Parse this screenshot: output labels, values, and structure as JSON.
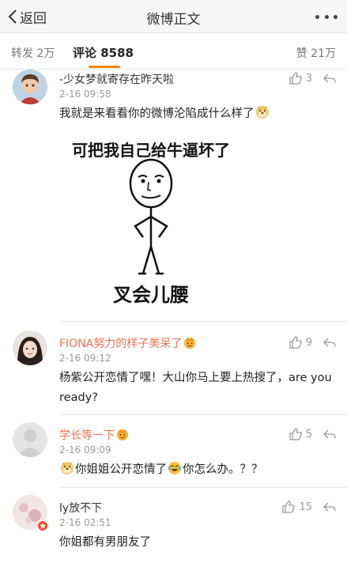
{
  "header": {
    "back_label": "返回",
    "title": "微博正文"
  },
  "tabs": {
    "reposts": "转发 2万",
    "comments": "评论 8588",
    "likes": "赞 21万"
  },
  "comments": [
    {
      "user": "-少女梦就寄存在昨天啦",
      "time": "2-16 09:58",
      "text": "我就是来看看你的微博沦陷成什么样了",
      "likes": "3",
      "user_color": "#333333",
      "meme": {
        "top_text": "可把我自己给牛逼坏了",
        "bottom_text": "叉会儿腰"
      }
    },
    {
      "user": "FIONA努力的样子美呆了",
      "time": "2-16 09:12",
      "text": "杨紫公开恋情了嘿！大山你马上要上热搜了，are you ready?",
      "likes": "9",
      "user_color": "#eb7350"
    },
    {
      "user": "学长等一下",
      "time": "2-16 09:09",
      "text_a": "你姐姐公开恋情了",
      "text_b": "你怎么办。？？",
      "likes": "5",
      "user_color": "#eb7350"
    },
    {
      "user": "ly放不下",
      "time": "2-16 02:51",
      "text": "你姐都有男朋友了",
      "likes": "15",
      "user_color": "#333333"
    }
  ],
  "colors": {
    "accent": "#ff8200",
    "username_vip": "#eb7350",
    "meta": "#999999"
  }
}
